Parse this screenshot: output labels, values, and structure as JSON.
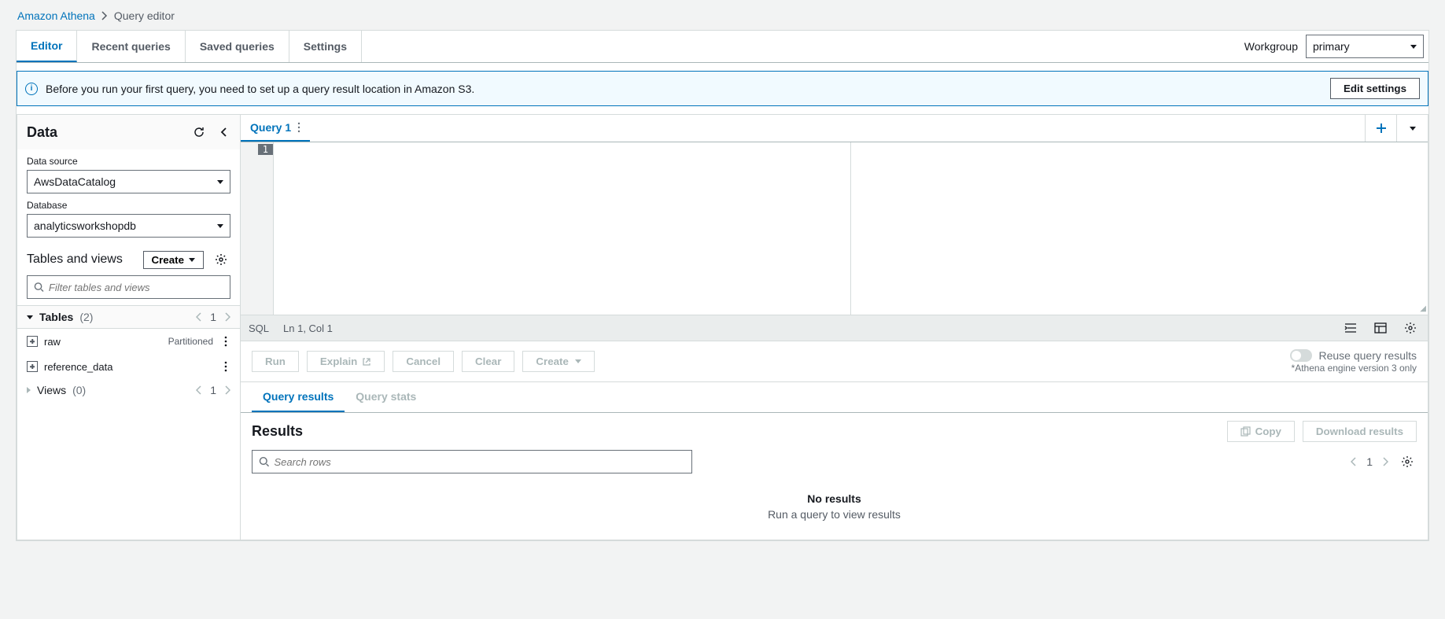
{
  "breadcrumb": {
    "root": "Amazon Athena",
    "current": "Query editor"
  },
  "tabs": {
    "editor": "Editor",
    "recent": "Recent queries",
    "saved": "Saved queries",
    "settings": "Settings"
  },
  "workgroup": {
    "label": "Workgroup",
    "value": "primary"
  },
  "alert": {
    "text": "Before you run your first query, you need to set up a query result location in Amazon S3.",
    "button": "Edit settings"
  },
  "sidebar": {
    "title": "Data",
    "dataSourceLabel": "Data source",
    "dataSourceValue": "AwsDataCatalog",
    "databaseLabel": "Database",
    "databaseValue": "analyticsworkshopdb",
    "tablesViewsTitle": "Tables and views",
    "createLabel": "Create",
    "filterPlaceholder": "Filter tables and views",
    "tablesLabel": "Tables",
    "tablesCount": "(2)",
    "tablesPage": "1",
    "viewsLabel": "Views",
    "viewsCount": "(0)",
    "viewsPage": "1",
    "tableItems": [
      {
        "name": "raw",
        "badge": "Partitioned"
      },
      {
        "name": "reference_data",
        "badge": ""
      }
    ]
  },
  "queryTabs": {
    "tab1": "Query 1"
  },
  "editor": {
    "line1": "1"
  },
  "status": {
    "lang": "SQL",
    "pos": "Ln 1, Col 1"
  },
  "actions": {
    "run": "Run",
    "explain": "Explain",
    "cancel": "Cancel",
    "clear": "Clear",
    "create": "Create",
    "reuseLabel": "Reuse query results",
    "engineNote": "*Athena engine version 3 only"
  },
  "resultTabs": {
    "results": "Query results",
    "stats": "Query stats"
  },
  "results": {
    "title": "Results",
    "copy": "Copy",
    "download": "Download results",
    "searchPlaceholder": "Search rows",
    "page": "1",
    "noResultsTitle": "No results",
    "noResultsSub": "Run a query to view results"
  }
}
